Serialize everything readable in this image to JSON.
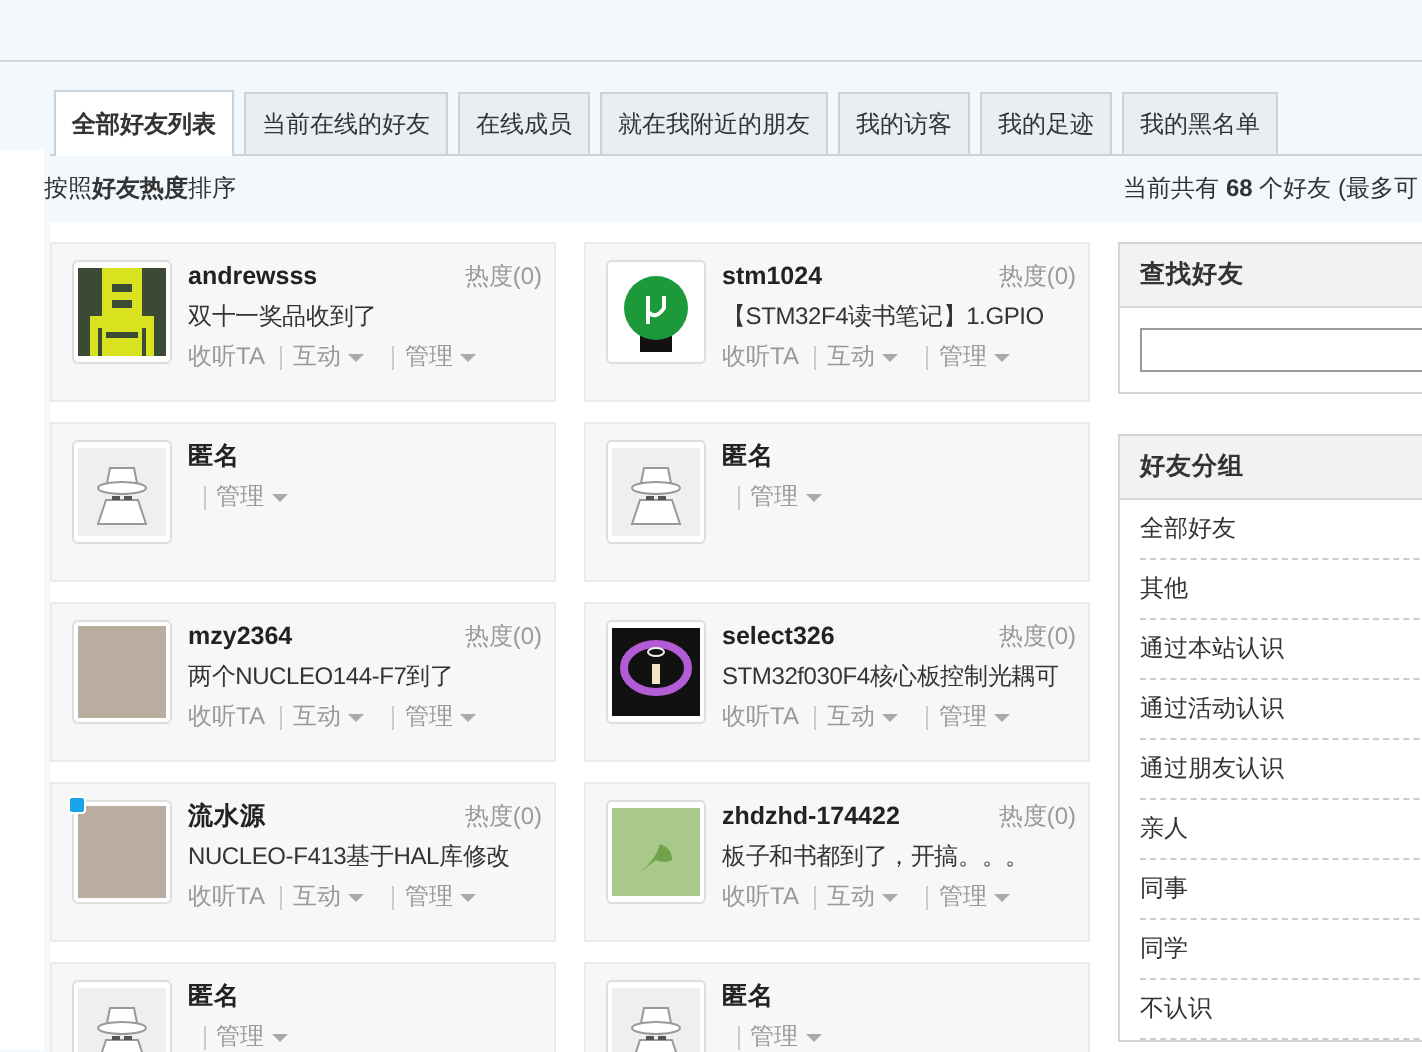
{
  "tabs": [
    {
      "label": "全部好友列表",
      "selected": true
    },
    {
      "label": "当前在线的好友",
      "selected": false
    },
    {
      "label": "在线成员",
      "selected": false
    },
    {
      "label": "就在我附近的朋友",
      "selected": false
    },
    {
      "label": "我的访客",
      "selected": false
    },
    {
      "label": "我的足迹",
      "selected": false
    },
    {
      "label": "我的黑名单",
      "selected": false
    }
  ],
  "sort_note": "按照**好友热度**排序",
  "count_note": "当前共有 **68** 个好友 (最多可",
  "friends": [
    {
      "name": "andrewsss",
      "kind": "pixel",
      "online": false,
      "heat": "热度(0)",
      "status": "双十一奖品收到了",
      "actions": [
        {
          "label": "收听TA",
          "menu": false
        },
        {
          "label": "互动",
          "menu": true
        },
        {
          "label": "管理",
          "menu": true
        }
      ]
    },
    {
      "name": "stm1024",
      "kind": "logo",
      "online": false,
      "heat": "热度(0)",
      "status": "【STM32F4读书笔记】1.GPIO",
      "actions": [
        {
          "label": "收听TA",
          "menu": false
        },
        {
          "label": "互动",
          "menu": true
        },
        {
          "label": "管理",
          "menu": true
        }
      ]
    },
    {
      "name": "匿名",
      "kind": "anonymous",
      "online": false,
      "actions": [
        {
          "label": "管理",
          "menu": true
        }
      ]
    },
    {
      "name": "匿名",
      "kind": "anonymous",
      "online": false,
      "actions": [
        {
          "label": "管理",
          "menu": true
        }
      ]
    },
    {
      "name": "mzy2364",
      "kind": "photo",
      "online": false,
      "heat": "热度(0)",
      "status": "两个NUCLEO144-F7到了",
      "actions": [
        {
          "label": "收听TA",
          "menu": false
        },
        {
          "label": "互动",
          "menu": true
        },
        {
          "label": "管理",
          "menu": true
        }
      ]
    },
    {
      "name": "select326",
      "kind": "glow",
      "online": false,
      "heat": "热度(0)",
      "status": "STM32f030F4核心板控制光耦可",
      "actions": [
        {
          "label": "收听TA",
          "menu": false
        },
        {
          "label": "互动",
          "menu": true
        },
        {
          "label": "管理",
          "menu": true
        }
      ]
    },
    {
      "name": "流水源",
      "kind": "photo",
      "online": true,
      "heat": "热度(0)",
      "status": "NUCLEO-F413基于HAL库修改",
      "actions": [
        {
          "label": "收听TA",
          "menu": false
        },
        {
          "label": "互动",
          "menu": true
        },
        {
          "label": "管理",
          "menu": true
        }
      ]
    },
    {
      "name": "zhdzhd-174422",
      "kind": "leaf",
      "online": false,
      "heat": "热度(0)",
      "status": "板子和书都到了，开搞。。。",
      "actions": [
        {
          "label": "收听TA",
          "menu": false
        },
        {
          "label": "互动",
          "menu": true
        },
        {
          "label": "管理",
          "menu": true
        }
      ]
    },
    {
      "name": "匿名",
      "kind": "anonymous",
      "online": false,
      "actions": [
        {
          "label": "管理",
          "menu": true
        }
      ]
    },
    {
      "name": "匿名",
      "kind": "anonymous",
      "online": false,
      "actions": [
        {
          "label": "管理",
          "menu": true
        }
      ]
    }
  ],
  "search_panel": {
    "title": "查找好友"
  },
  "groups_panel": {
    "title": "好友分组",
    "items": [
      "全部好友",
      "其他",
      "通过本站认识",
      "通过活动认识",
      "通过朋友认识",
      "亲人",
      "同事",
      "同学",
      "不认识"
    ]
  }
}
